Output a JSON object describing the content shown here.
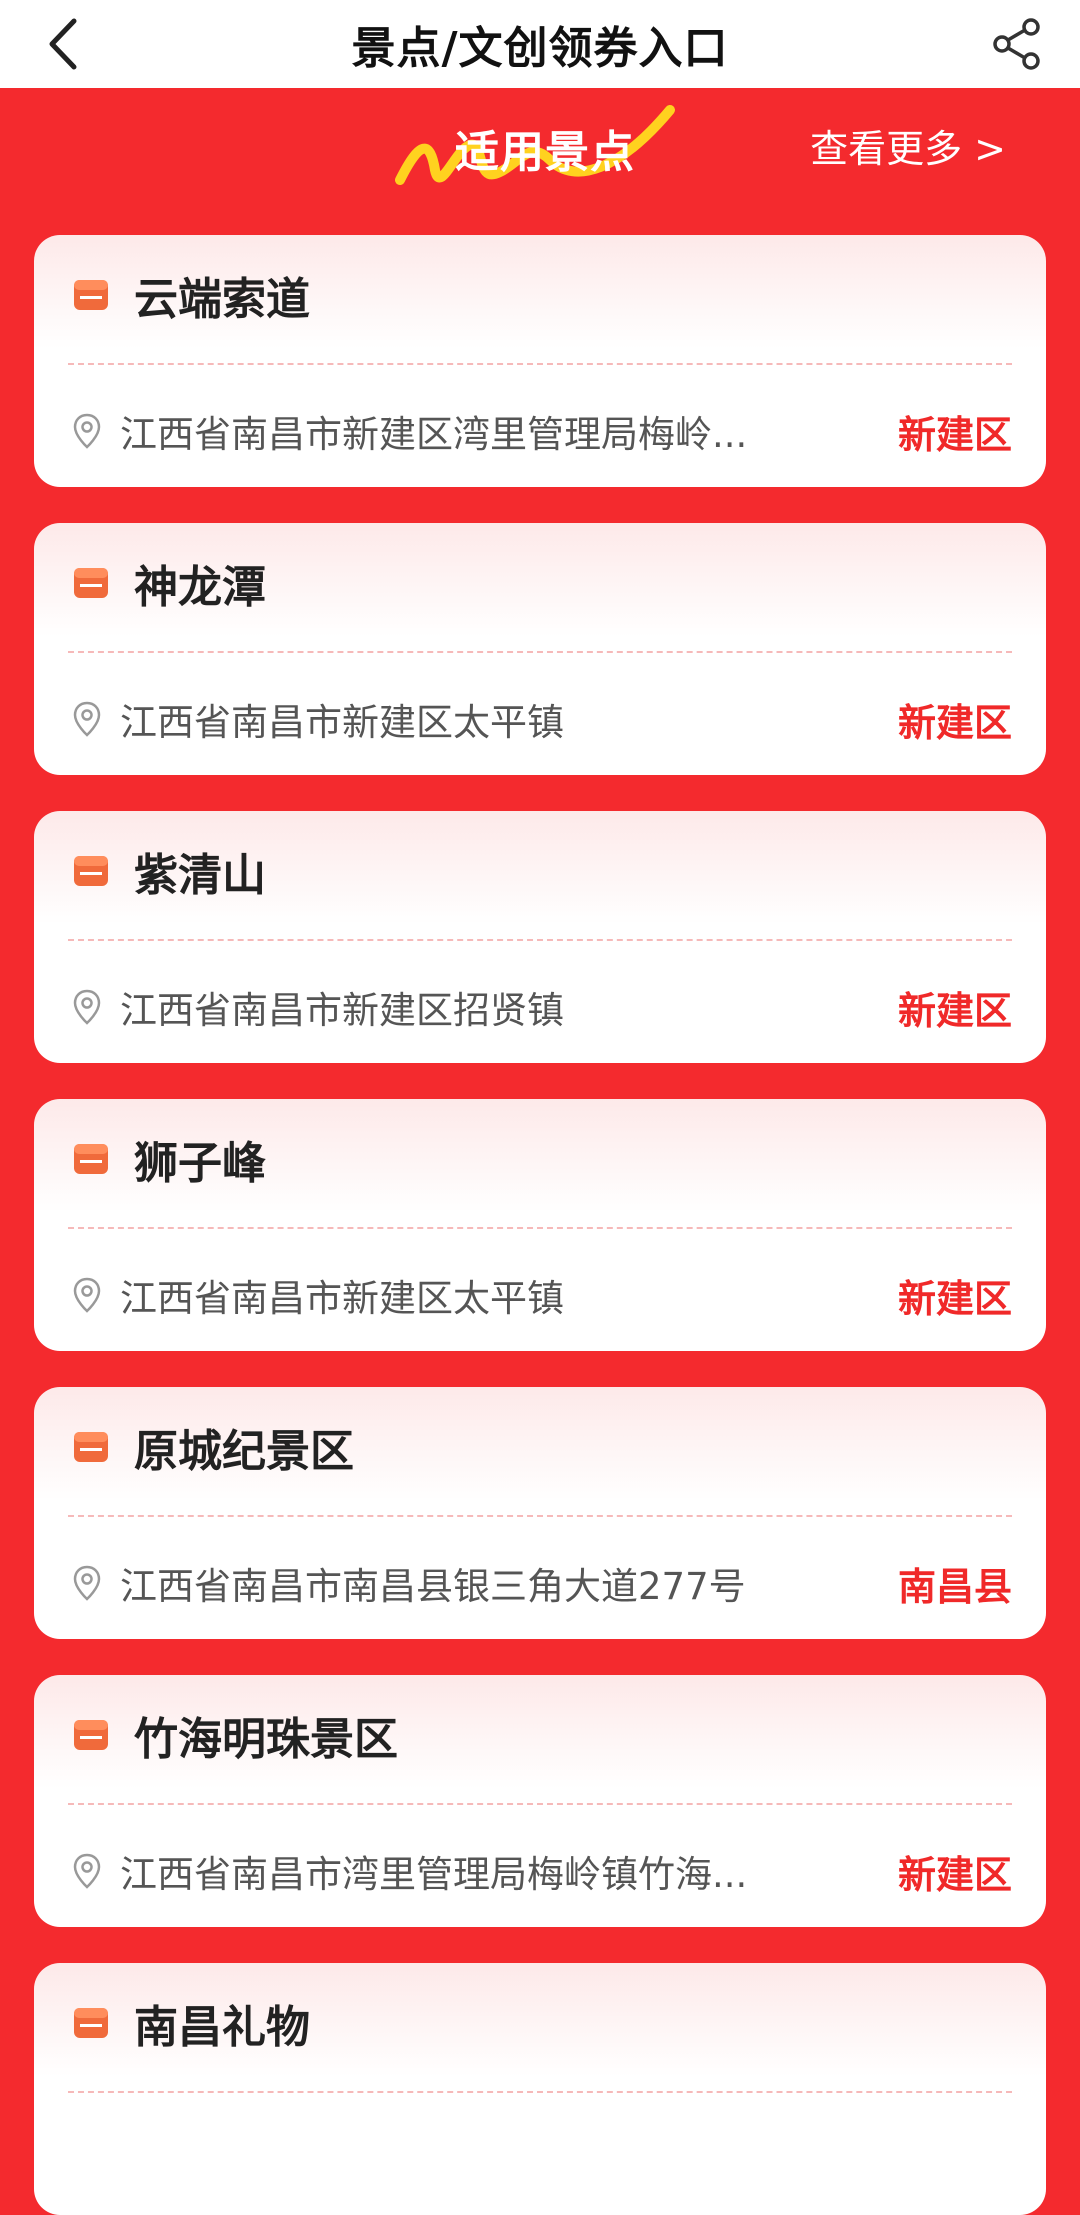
{
  "header": {
    "title": "景点/文创领券入口",
    "back_icon": "chevron-left-icon",
    "share_icon": "share-icon"
  },
  "banner": {
    "title": "适用景点",
    "more": "查看更多 >"
  },
  "colors": {
    "accent": "#f42a2e",
    "district": "#f02929",
    "logo_yellow": "#ffd21f"
  },
  "scenic_spots": [
    {
      "name": "云端索道",
      "address": "江西省南昌市新建区湾里管理局梅岭...",
      "district": "新建区"
    },
    {
      "name": "神龙潭",
      "address": "江西省南昌市新建区太平镇",
      "district": "新建区"
    },
    {
      "name": "紫清山",
      "address": "江西省南昌市新建区招贤镇",
      "district": "新建区"
    },
    {
      "name": "狮子峰",
      "address": "江西省南昌市新建区太平镇",
      "district": "新建区"
    },
    {
      "name": "原城纪景区",
      "address": "江西省南昌市南昌县银三角大道277号",
      "district": "南昌县"
    },
    {
      "name": "竹海明珠景区",
      "address": "江西省南昌市湾里管理局梅岭镇竹海...",
      "district": "新建区"
    },
    {
      "name": "南昌礼物",
      "address": "",
      "district": ""
    }
  ]
}
